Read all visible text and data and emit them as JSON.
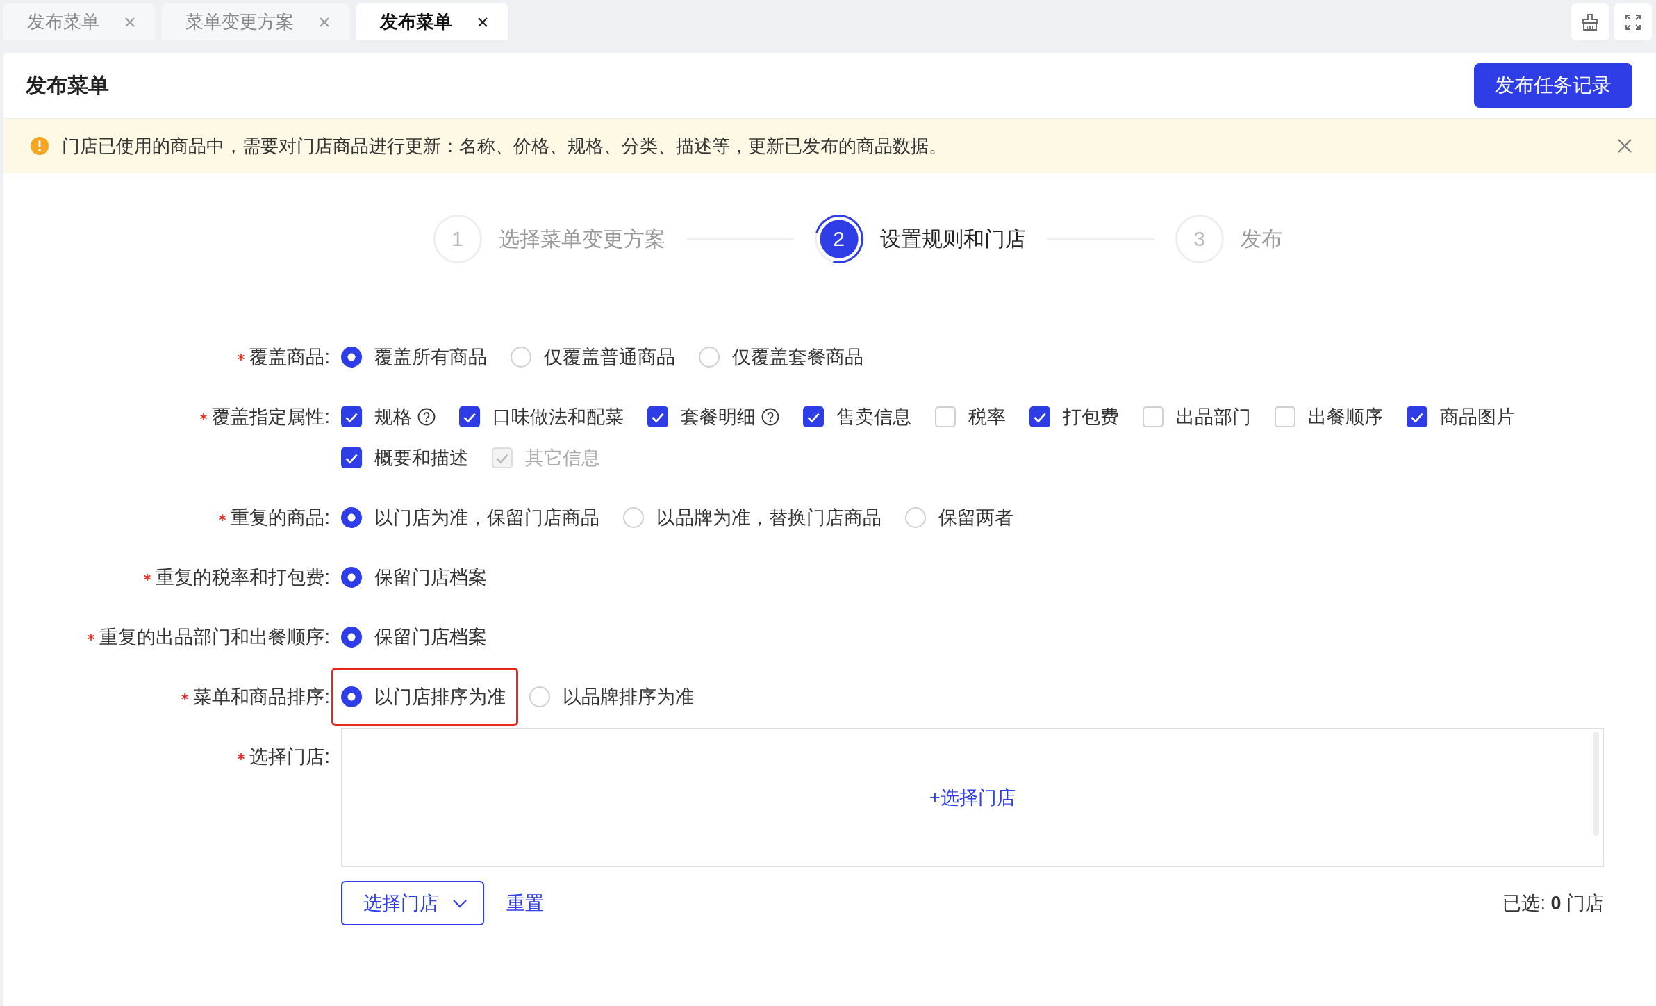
{
  "tabs": [
    {
      "label": "发布菜单",
      "selected": false
    },
    {
      "label": "菜单变更方案",
      "selected": false
    },
    {
      "label": "发布菜单",
      "selected": true
    }
  ],
  "page": {
    "title": "发布菜单",
    "action_button": "发布任务记录"
  },
  "alert": {
    "text": "门店已使用的商品中，需要对门店商品进行更新：名称、价格、规格、分类、描述等，更新已发布的商品数据。"
  },
  "steps": [
    {
      "number": "1",
      "label": "选择菜单变更方案",
      "current": false
    },
    {
      "number": "2",
      "label": "设置规则和门店",
      "current": true
    },
    {
      "number": "3",
      "label": "发布",
      "current": false
    }
  ],
  "form": {
    "fields": [
      {
        "label": "覆盖商品:",
        "required": true,
        "kind": "radio",
        "options": [
          {
            "label": "覆盖所有商品",
            "selected": true
          },
          {
            "label": "仅覆盖普通商品",
            "selected": false
          },
          {
            "label": "仅覆盖套餐商品",
            "selected": false
          }
        ]
      },
      {
        "label": "覆盖指定属性:",
        "required": true,
        "kind": "checkbox",
        "options": [
          {
            "label": "规格",
            "checked": true,
            "disabled": false,
            "help": true
          },
          {
            "label": "口味做法和配菜",
            "checked": true,
            "disabled": false,
            "help": false
          },
          {
            "label": "套餐明细",
            "checked": true,
            "disabled": false,
            "help": true
          },
          {
            "label": "售卖信息",
            "checked": true,
            "disabled": false,
            "help": false
          },
          {
            "label": "税率",
            "checked": false,
            "disabled": false,
            "help": false
          },
          {
            "label": "打包费",
            "checked": true,
            "disabled": false,
            "help": false
          },
          {
            "label": "出品部门",
            "checked": false,
            "disabled": false,
            "help": false
          },
          {
            "label": "出餐顺序",
            "checked": false,
            "disabled": false,
            "help": false
          },
          {
            "label": "商品图片",
            "checked": true,
            "disabled": false,
            "help": false
          },
          {
            "label": "概要和描述",
            "checked": true,
            "disabled": false,
            "help": false
          },
          {
            "label": "其它信息",
            "checked": true,
            "disabled": true,
            "help": false
          }
        ]
      },
      {
        "label": "重复的商品:",
        "required": true,
        "kind": "radio",
        "options": [
          {
            "label": "以门店为准，保留门店商品",
            "selected": true
          },
          {
            "label": "以品牌为准，替换门店商品",
            "selected": false
          },
          {
            "label": "保留两者",
            "selected": false
          }
        ]
      },
      {
        "label": "重复的税率和打包费:",
        "required": true,
        "kind": "radio",
        "options": [
          {
            "label": "保留门店档案",
            "selected": true
          }
        ]
      },
      {
        "label": "重复的出品部门和出餐顺序:",
        "required": true,
        "kind": "radio",
        "options": [
          {
            "label": "保留门店档案",
            "selected": true
          }
        ]
      },
      {
        "label": "菜单和商品排序:",
        "required": true,
        "kind": "radio",
        "options": [
          {
            "label": "以门店排序为准",
            "selected": true,
            "highlighted": true
          },
          {
            "label": "以品牌排序为准",
            "selected": false,
            "highlighted": false
          }
        ]
      },
      {
        "label": "选择门店:",
        "required": true,
        "kind": "stores",
        "add_link": "+选择门店",
        "dropdown_button": "选择门店",
        "reset_link": "重置",
        "selected_count": "已选: **0** 门店"
      }
    ]
  }
}
